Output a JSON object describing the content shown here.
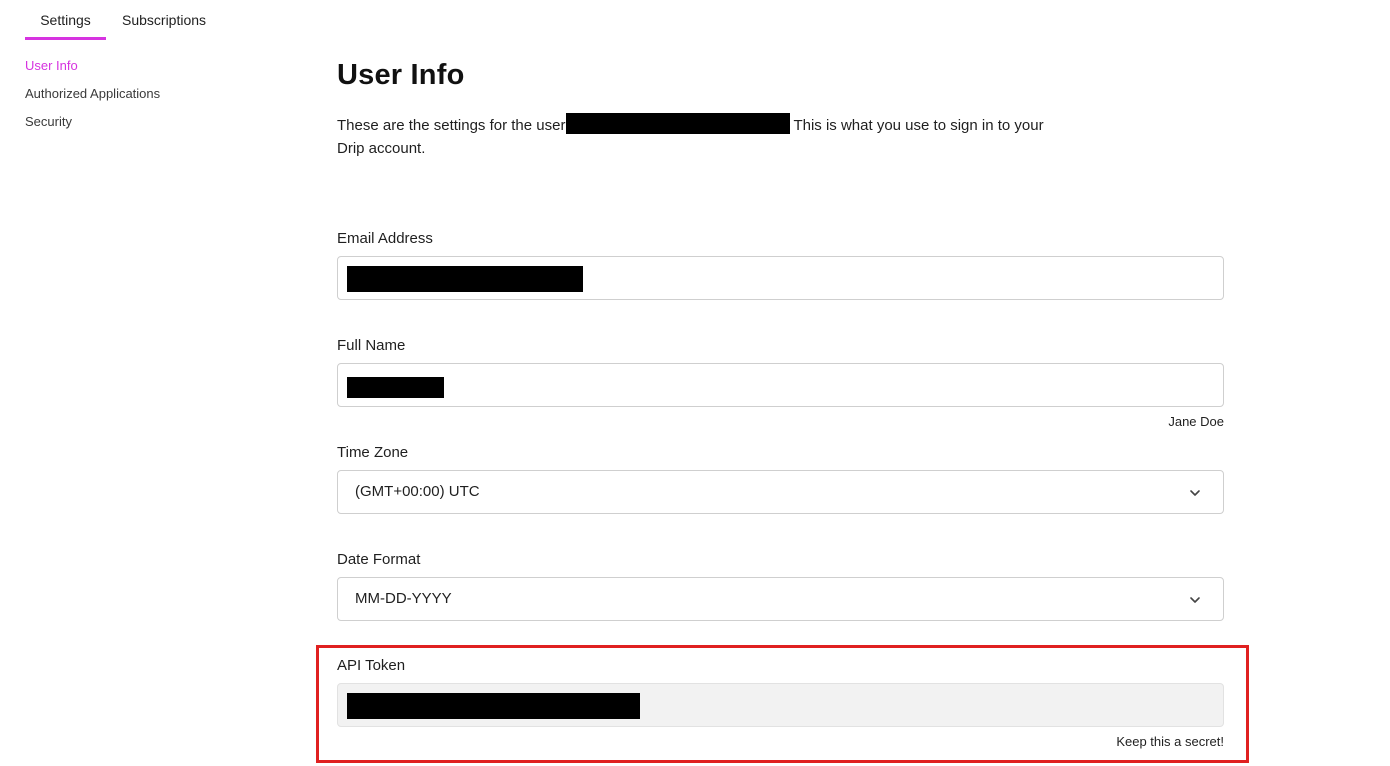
{
  "tabs": [
    {
      "label": "Settings",
      "active": true
    },
    {
      "label": "Subscriptions",
      "active": false
    }
  ],
  "sidebar": {
    "items": [
      {
        "label": "User Info",
        "active": true
      },
      {
        "label": "Authorized Applications",
        "active": false
      },
      {
        "label": "Security",
        "active": false
      }
    ]
  },
  "main": {
    "title": "User Info",
    "intro_before": "These are the settings for the user",
    "intro_after": "This is what you use to sign in to your Drip account.",
    "email": {
      "label": "Email Address"
    },
    "full_name": {
      "label": "Full Name",
      "hint": "Jane Doe"
    },
    "time_zone": {
      "label": "Time Zone",
      "value": "(GMT+00:00) UTC"
    },
    "date_format": {
      "label": "Date Format",
      "value": "MM-DD-YYYY"
    },
    "api_token": {
      "label": "API Token",
      "hint": "Keep this a secret!"
    }
  },
  "colors": {
    "accent": "#d633e0",
    "highlight": "#e02020",
    "redaction": "#000000"
  }
}
